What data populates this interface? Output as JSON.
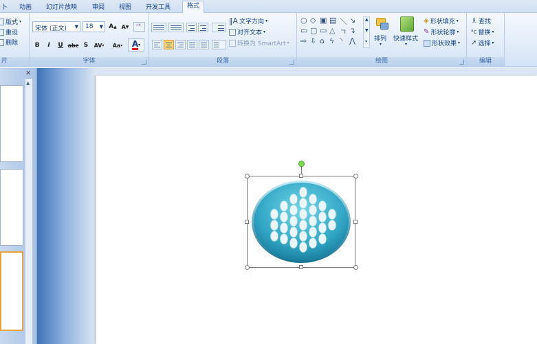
{
  "tabs": [
    {
      "label": "卜"
    },
    {
      "label": "动画"
    },
    {
      "label": "幻灯片放映"
    },
    {
      "label": "审阅"
    },
    {
      "label": "视图"
    },
    {
      "label": "开发工具"
    },
    {
      "label": "格式"
    }
  ],
  "ribbon": {
    "slides_group": {
      "label": "片",
      "items": [
        "版式",
        "重设",
        "删除"
      ]
    },
    "font_group": {
      "label": "字体",
      "font_name": "宋体 (正文)",
      "font_size": "18",
      "grow_label": "A",
      "shrink_label": "A",
      "bold": "B",
      "italic": "I",
      "underline": "U",
      "strike": "abc",
      "shadow": "S",
      "spacing": "AV",
      "case": "Aa",
      "color": "A"
    },
    "paragraph_group": {
      "label": "段落",
      "text_direction": "文字方向",
      "align_text": "对齐文本",
      "smartart": "转换为 SmartArt"
    },
    "drawing_group": {
      "label": "绘图",
      "arrange": "排列",
      "quick_styles": "快速样式",
      "shape_fill": "形状填充",
      "shape_outline": "形状轮廓",
      "shape_effects": "形状效果"
    },
    "editing_group": {
      "label": "编辑",
      "find": "查找",
      "replace": "替换",
      "select": "选择"
    }
  },
  "panel": {
    "close_glyph": "×"
  },
  "colors": {
    "accent": "#15428b",
    "shape_fill_top": "#6ed3e6",
    "shape_fill_bottom": "#1f8fb0",
    "dot": "#eaf6fb",
    "rotation_handle": "#7ddc4c"
  }
}
